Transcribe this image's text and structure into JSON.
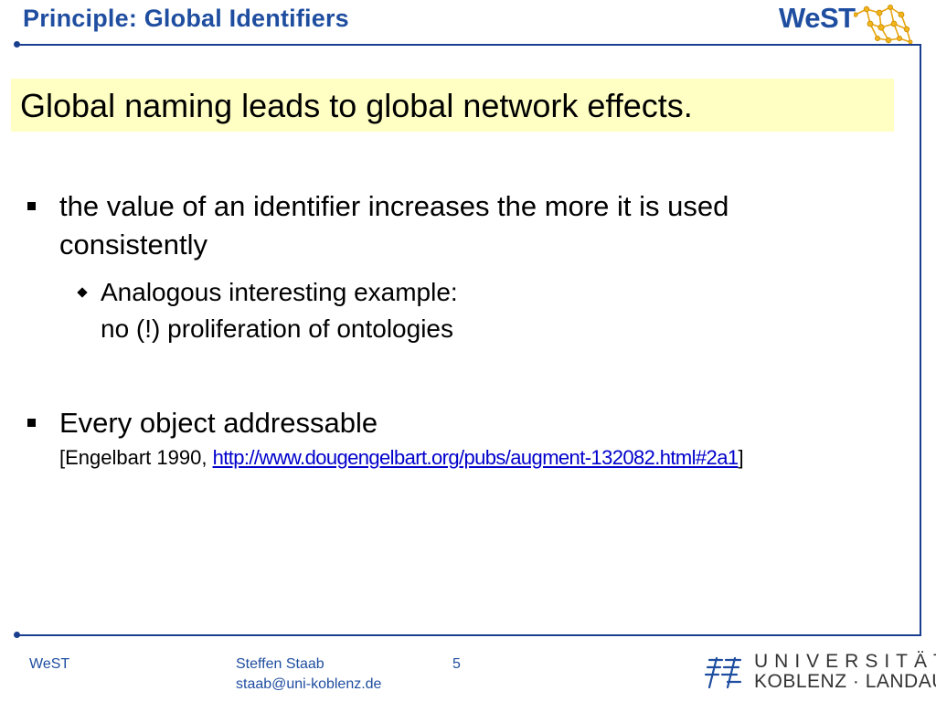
{
  "header": {
    "title": "Principle: Global Identifiers",
    "logo_text": "WeST"
  },
  "highlight": {
    "text": "Global naming leads to global network effects."
  },
  "bullets": [
    {
      "line1": "the value of an identifier increases the more it is used",
      "line2": "consistently",
      "sub": {
        "line1": "Analogous interesting example:",
        "line2": "no (!) proliferation of ontologies"
      }
    },
    {
      "line1": "Every object addressable",
      "ref_prefix": "[Engelbart 1990, ",
      "ref_link": "http://www.dougengelbart.org/pubs/augment-132082.html#2a1",
      "ref_suffix": "]"
    }
  ],
  "footer": {
    "left": "WeST",
    "author": "Steffen Staab",
    "email": "staab@uni-koblenz.de",
    "page_number": "5",
    "university_line1": "UNIVERSITÄT",
    "university_line2": "KOBLENZ · LANDAU"
  },
  "colors": {
    "accent": "#1f4ea0",
    "highlight_bg": "#ffffc4",
    "link": "#0000cc"
  }
}
